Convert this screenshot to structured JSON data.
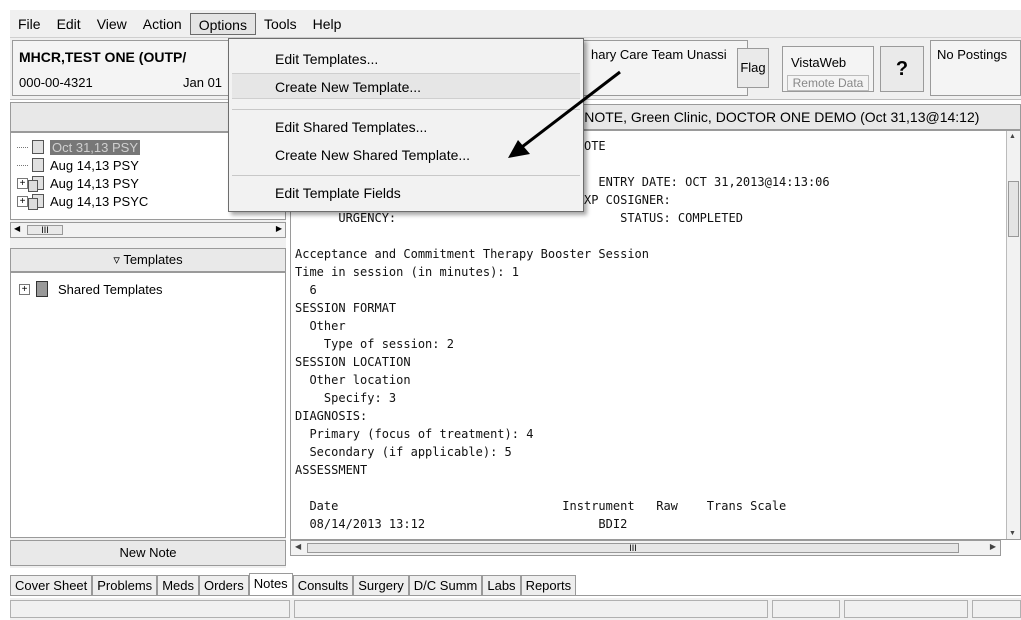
{
  "menubar": {
    "items": [
      "File",
      "Edit",
      "View",
      "Action",
      "Options",
      "Tools",
      "Help"
    ]
  },
  "patient": {
    "name": "MHCR,TEST ONE (OUTP/",
    "ssn": "000-00-4321",
    "date": "Jan 01"
  },
  "header": {
    "care_team": "hary Care Team Unassi",
    "flag": "Flag",
    "vistaweb": "VistaWeb",
    "remote_data": "Remote Data",
    "help": "?",
    "postings": "No Postings"
  },
  "options_menu": {
    "items": [
      "Edit Templates...",
      "Create New Template...",
      "Edit Shared Templates...",
      "Create New Shared Template...",
      "Edit Template Fields"
    ]
  },
  "notes_tree": {
    "rows": [
      {
        "label": "Oct 31,13 PSY",
        "selected": true
      },
      {
        "label": "Aug 14,13 PSY",
        "selected": false
      },
      {
        "label": "Aug 14,13 PSY",
        "selected": false
      },
      {
        "label": "Aug 14,13 PSYC",
        "selected": false
      }
    ],
    "scroll_thumb": "III"
  },
  "templates": {
    "header": "Templates",
    "items": [
      {
        "label": "Shared Templates"
      }
    ]
  },
  "new_note_button": "New Note",
  "note_header": "S NOTE, Green Clinic, DOCTOR ONE DEMO  (Oct 31,13@14:12)",
  "note_lines": [
    "                                  RESS NOTE",
    "                                  TE",
    "                                  12      ENTRY DATE: OCT 31,2013@14:13:06",
    "                                       EXP COSIGNER:",
    "      URGENCY:                               STATUS: COMPLETED",
    "",
    "Acceptance and Commitment Therapy Booster Session",
    "Time in session (in minutes): 1",
    "  6",
    "SESSION FORMAT",
    "  Other",
    "    Type of session: 2",
    "SESSION LOCATION",
    "  Other location",
    "    Specify: 3",
    "DIAGNOSIS:",
    "  Primary (focus of treatment): 4",
    "  Secondary (if applicable): 5",
    "ASSESSMENT",
    "",
    "  Date                               Instrument   Raw    Trans Scale",
    "  08/14/2013 13:12                        BDI2"
  ],
  "note_scroll_thumb": "III",
  "tabs": [
    "Cover Sheet",
    "Problems",
    "Meds",
    "Orders",
    "Notes",
    "Consults",
    "Surgery",
    "D/C Summ",
    "Labs",
    "Reports"
  ],
  "active_tab": "Notes"
}
